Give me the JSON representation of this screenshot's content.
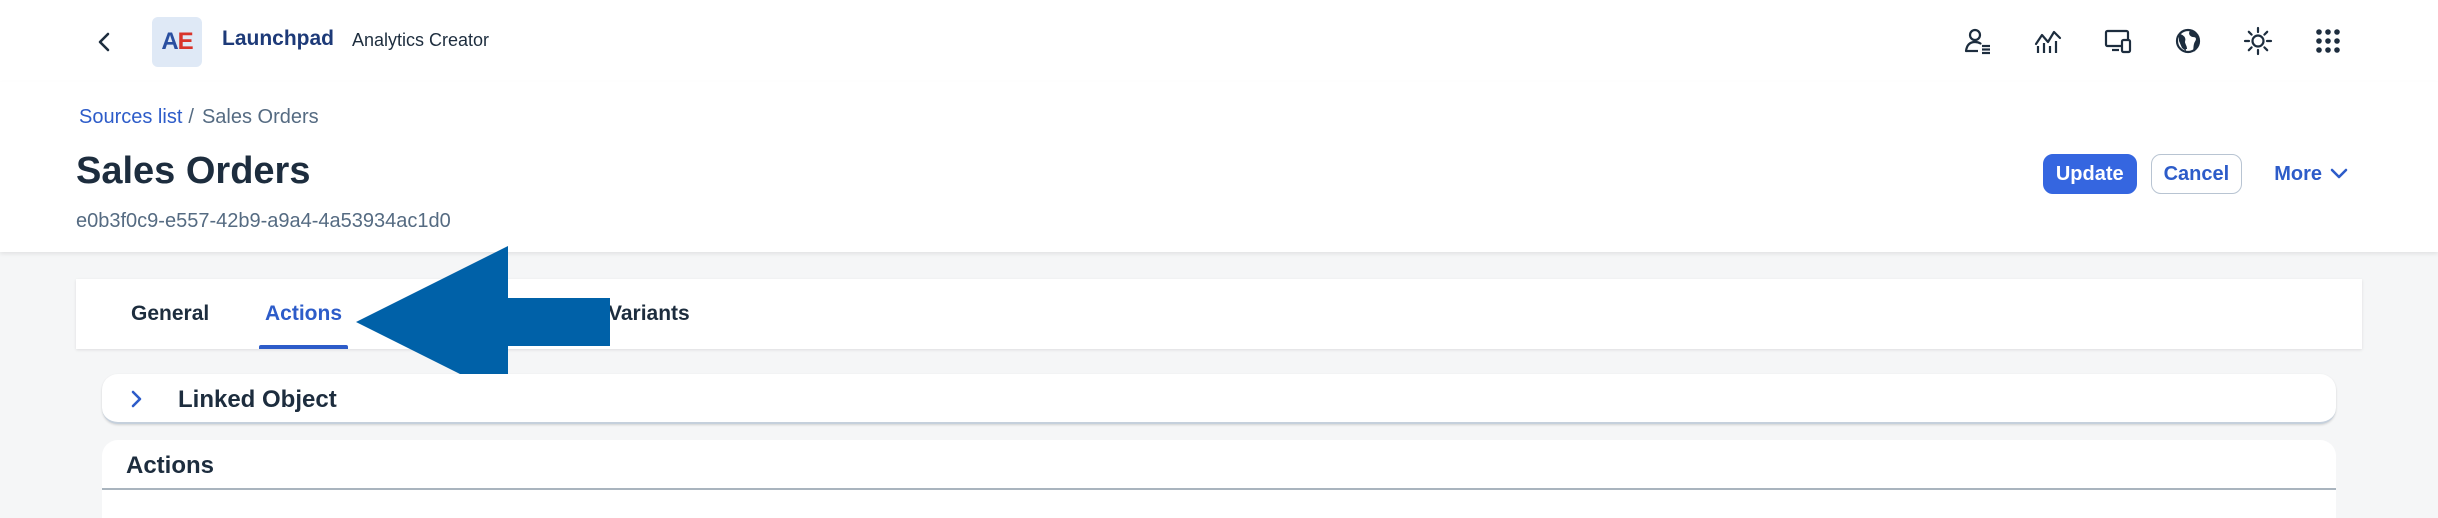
{
  "shell": {
    "logo_a": "A",
    "logo_e": "E",
    "title": "Launchpad",
    "subtitle": "Analytics Creator",
    "icons": [
      "user-settings-icon",
      "analytics-icon",
      "devices-icon",
      "globe-icon",
      "theme-icon",
      "app-grid-icon"
    ]
  },
  "breadcrumb": {
    "link": "Sources list",
    "separator": "/",
    "current": "Sales Orders"
  },
  "header": {
    "title": "Sales Orders",
    "id": "e0b3f0c9-e557-42b9-a9a4-4a53934ac1d0",
    "update_label": "Update",
    "cancel_label": "Cancel",
    "more_label": "More"
  },
  "tabs": [
    {
      "label": "General",
      "active": false
    },
    {
      "label": "Actions",
      "active": true
    },
    {
      "label": "Variants",
      "active": false
    }
  ],
  "panels": {
    "linked_object": "Linked Object",
    "actions": "Actions"
  },
  "colors": {
    "accent": "#2d5cc9",
    "primary_button": "#3566e0",
    "arrow": "#0061a8"
  }
}
